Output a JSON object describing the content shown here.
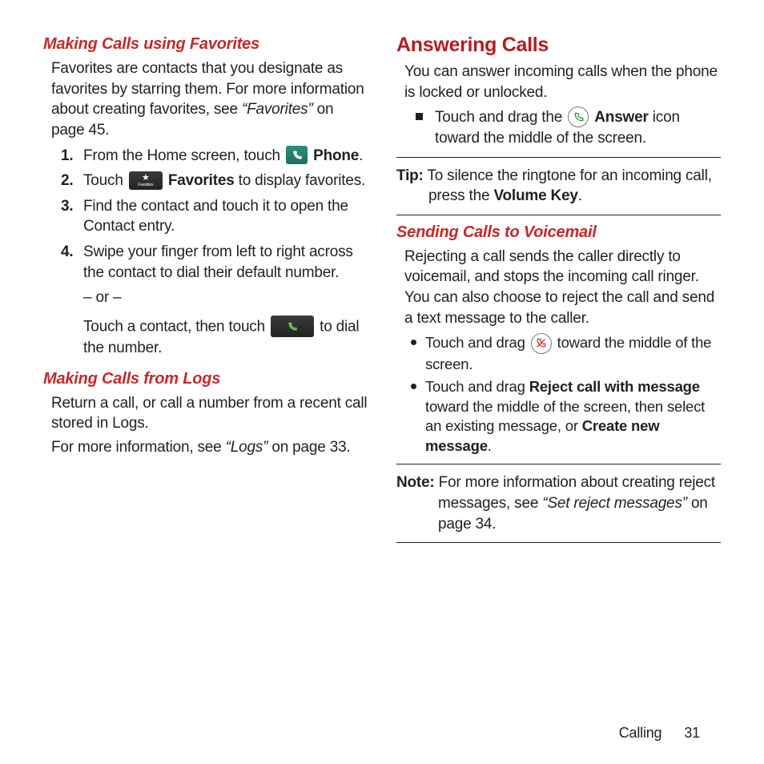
{
  "left": {
    "h_fav": "Making Calls using Favorites",
    "fav_intro_a": "Favorites are contacts that you designate as favorites by starring them. For more information about creating favorites, see ",
    "fav_intro_ref": "“Favorites”",
    "fav_intro_b": " on page 45.",
    "steps": {
      "s1a": "From the Home screen, touch ",
      "s1b": "Phone",
      "s1c": ".",
      "s2a": "Touch ",
      "s2b": "Favorites",
      "s2c": " to display favorites.",
      "s3": "Find the contact and touch it to open the Contact entry.",
      "s4": "Swipe your finger from left to right across the contact to dial their default number.",
      "or": "– or –",
      "alt_a": "Touch a contact, then touch ",
      "alt_b": " to dial the number."
    },
    "fav_icon_label": "Favorites",
    "h_logs": "Making Calls from Logs",
    "logs_p1": "Return a call, or call a number from a recent call stored in Logs.",
    "logs_p2a": "For more information, see ",
    "logs_p2ref": "“Logs”",
    "logs_p2b": " on page 33."
  },
  "right": {
    "h_ans": "Answering Calls",
    "ans_intro": "You can answer incoming calls when the phone is locked or unlocked.",
    "ans_b1a": "Touch and drag the ",
    "ans_b1b": "Answer",
    "ans_b1c": " icon toward the middle of the screen.",
    "tip_label": "Tip:",
    "tip_a": " To silence the ringtone for an incoming call, press the ",
    "tip_bold": "Volume Key",
    "tip_b": ".",
    "h_vm": "Sending Calls to Voicemail",
    "vm_intro": "Rejecting a call sends the caller directly to voicemail, and stops the incoming call ringer. You can also choose to reject the call and send a text message to the caller.",
    "vm_b1a": "Touch and drag ",
    "vm_b1b": " toward the middle of the screen.",
    "vm_b2a": "Touch and drag ",
    "vm_b2bold1": "Reject call with message",
    "vm_b2b": " toward the middle of the screen, then select an existing message, or ",
    "vm_b2bold2": "Create new message",
    "vm_b2c": ".",
    "note_label": "Note:",
    "note_a": " For more information about creating reject messages, see ",
    "note_ref": "“Set reject messages”",
    "note_b": " on page 34."
  },
  "footer": {
    "section": "Calling",
    "page": "31"
  }
}
